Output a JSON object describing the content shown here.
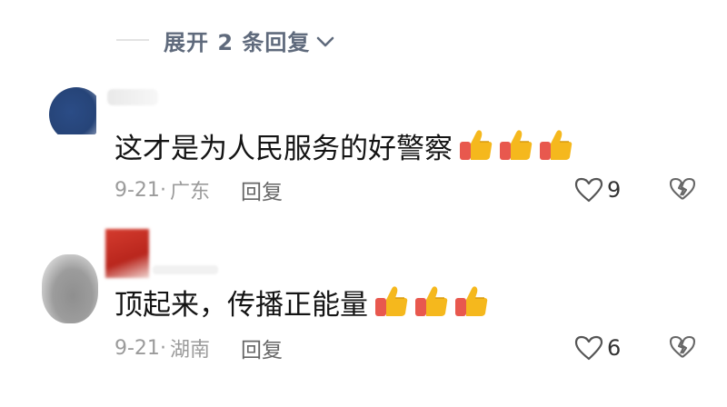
{
  "expand_replies": {
    "label": "展开 2 条回复",
    "icon": "chevron-down-icon"
  },
  "comments": [
    {
      "text": "这才是为人民服务的好警察",
      "emojis": [
        "thumbs-up-icon",
        "thumbs-up-icon",
        "thumbs-up-icon"
      ],
      "date": "9-21",
      "separator": "·",
      "location": "广东",
      "reply_label": "回复",
      "likes": "9"
    },
    {
      "text": "顶起来，传播正能量",
      "emojis": [
        "thumbs-up-icon",
        "thumbs-up-icon",
        "thumbs-up-icon"
      ],
      "date": "9-21",
      "separator": "·",
      "location": "湖南",
      "reply_label": "回复",
      "likes": "6"
    }
  ],
  "colors": {
    "text": "#141414",
    "meta": "#9b9b9b",
    "expand": "#5f6a7c",
    "thumb": "#f5b81d",
    "sleeve": "#e8584e"
  }
}
